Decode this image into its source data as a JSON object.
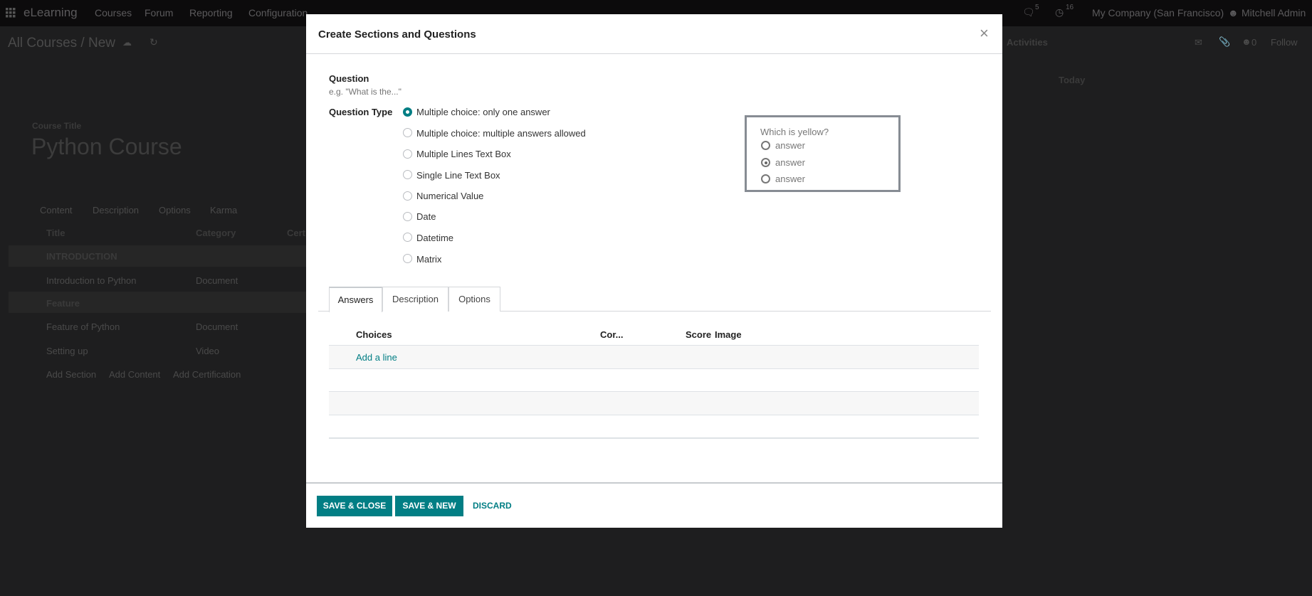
{
  "navbar": {
    "app": "eLearning",
    "menu": [
      "Courses",
      "Forum",
      "Reporting",
      "Configuration"
    ],
    "messages_count": "5",
    "activities_count": "16",
    "company": "My Company (San Francisco)",
    "user": "Mitchell Admin"
  },
  "control": {
    "breadcrumb": "All Courses / New",
    "activities": "Activities",
    "followers": "0",
    "follow": "Follow",
    "today": "Today"
  },
  "form": {
    "course_title_label": "Course Title",
    "course_title": "Python Course",
    "tabs": [
      "Content",
      "Description",
      "Options",
      "Karma"
    ],
    "columns": [
      "Title",
      "Category",
      "Cert"
    ],
    "rows": [
      {
        "title": "INTRODUCTION",
        "category": "",
        "section": true
      },
      {
        "title": "Introduction to Python",
        "category": "Document"
      },
      {
        "title": "Feature",
        "category": "",
        "section": true
      },
      {
        "title": "Feature of Python",
        "category": "Document"
      },
      {
        "title": "Setting up",
        "category": "Video"
      }
    ],
    "add_links": [
      "Add Section",
      "Add Content",
      "Add Certification"
    ]
  },
  "modal": {
    "title": "Create Sections and Questions",
    "question_label": "Question",
    "question_placeholder": "e.g. \"What is the...\"",
    "question_type_label": "Question Type",
    "question_types": [
      "Multiple choice: only one answer",
      "Multiple choice: multiple answers allowed",
      "Multiple Lines Text Box",
      "Single Line Text Box",
      "Numerical Value",
      "Date",
      "Datetime",
      "Matrix"
    ],
    "selected_type": "Multiple choice: only one answer",
    "preview": {
      "question": "Which is yellow?",
      "answers": [
        "answer",
        "answer",
        "answer"
      ],
      "selected_index": 1
    },
    "tabs": [
      "Answers",
      "Description",
      "Options"
    ],
    "active_tab": "Answers",
    "columns": [
      "Choices",
      "Cor...",
      "Score",
      "Image"
    ],
    "add_line": "Add a line",
    "buttons": {
      "save_close": "SAVE & CLOSE",
      "save_new": "SAVE & NEW",
      "discard": "DISCARD"
    }
  },
  "colors": {
    "accent": "#017e84",
    "navbar": "#0c0b0c",
    "backdrop": "#1e1e1f"
  }
}
